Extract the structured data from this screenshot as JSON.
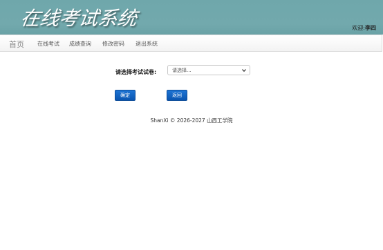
{
  "header": {
    "title": "在线考试系统",
    "welcome_label": "欢迎:",
    "username": "李四"
  },
  "nav": {
    "home": "首页",
    "items": [
      {
        "label": "在线考试"
      },
      {
        "label": "成绩查询"
      },
      {
        "label": "修改密码"
      },
      {
        "label": "退出系统"
      }
    ]
  },
  "form": {
    "label": "请选择考试试卷:",
    "select_value": "请选择...",
    "confirm_label": "确定",
    "back_label": "返回"
  },
  "footer": {
    "text": "ShanXi © 2026-2027 山西工学院"
  },
  "colors": {
    "banner": "#6fa7ab",
    "button": "#1d74d4"
  }
}
